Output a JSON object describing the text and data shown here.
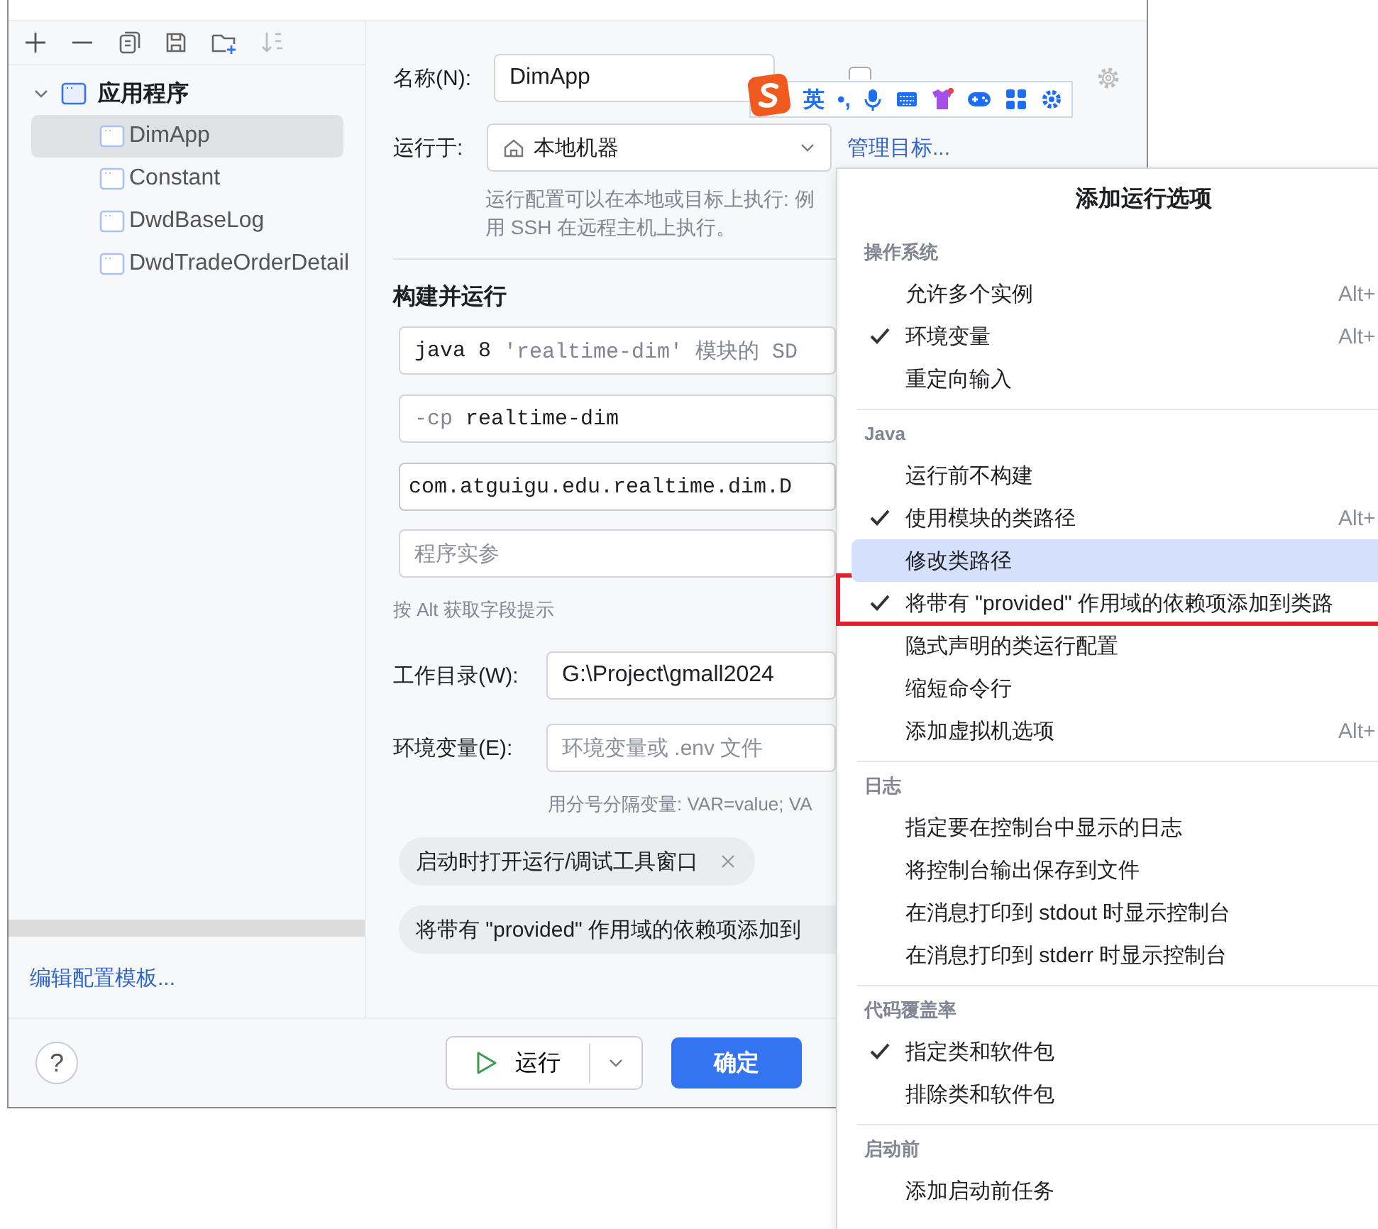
{
  "sidebar": {
    "tree": {
      "label": "应用程序",
      "expanded": true,
      "children": [
        {
          "label": "DimApp",
          "selected": true
        },
        {
          "label": "Constant",
          "selected": false
        },
        {
          "label": "DwdBaseLog",
          "selected": false
        },
        {
          "label": "DwdTradeOrderDetail",
          "selected": false
        }
      ]
    },
    "template_link": "编辑配置模板..."
  },
  "form": {
    "name_label": "名称(N):",
    "name_value": "DimApp",
    "store_checkbox": {
      "checked": false
    },
    "run_on_label": "运行于:",
    "run_on_value": "本地机器",
    "manage_link": "管理目标...",
    "run_on_hint": [
      "运行配置可以在本地或目标上执行: 例",
      "用 SSH 在远程主机上执行。"
    ],
    "section_title": "构建并运行",
    "jre": {
      "value": "java 8",
      "hint": "'realtime-dim' 模块的 SD"
    },
    "classpath": {
      "flag": "-cp",
      "value": "realtime-dim"
    },
    "main_class": "com.atguigu.edu.realtime.dim.D",
    "program_args": {
      "placeholder": "程序实参"
    },
    "field_hint": "按 Alt 获取字段提示",
    "workdir_label": "工作目录(W):",
    "workdir_value": "G:\\Project\\gmall2024",
    "env_label": "环境变量(E):",
    "env_placeholder": "环境变量或 .env 文件",
    "env_hint": "用分号分隔变量: VAR=value; VA",
    "chips": [
      {
        "label": "启动时打开运行/调试工具窗口",
        "removable": true
      },
      {
        "label": "将带有 \"provided\" 作用域的依赖项添加到",
        "removable": false
      }
    ]
  },
  "footer": {
    "help": "?",
    "run_button": "运行",
    "ok_button": "确定"
  },
  "ime_toolbar": {
    "mode": "英",
    "punct": "•,"
  },
  "menu": {
    "title": "添加运行选项",
    "groups": [
      {
        "label": "操作系统",
        "items": [
          {
            "label": "允许多个实例",
            "checked": false,
            "selected": false,
            "shortcut": "Alt+"
          },
          {
            "label": "环境变量",
            "checked": true,
            "selected": false,
            "shortcut": "Alt+"
          },
          {
            "label": "重定向输入",
            "checked": false,
            "selected": false
          }
        ]
      },
      {
        "label": "Java",
        "items": [
          {
            "label": "运行前不构建",
            "checked": false,
            "selected": false
          },
          {
            "label": "使用模块的类路径",
            "checked": true,
            "selected": false,
            "shortcut": "Alt+"
          },
          {
            "label": "修改类路径",
            "checked": false,
            "selected": true
          },
          {
            "label": "将带有 \"provided\" 作用域的依赖项添加到类路",
            "checked": true,
            "selected": false
          },
          {
            "label": "隐式声明的类运行配置",
            "checked": false,
            "selected": false
          },
          {
            "label": "缩短命令行",
            "checked": false,
            "selected": false
          },
          {
            "label": "添加虚拟机选项",
            "checked": false,
            "selected": false,
            "shortcut": "Alt+"
          }
        ]
      },
      {
        "label": "日志",
        "items": [
          {
            "label": "指定要在控制台中显示的日志",
            "checked": false,
            "selected": false
          },
          {
            "label": "将控制台输出保存到文件",
            "checked": false,
            "selected": false
          },
          {
            "label": "在消息打印到 stdout 时显示控制台",
            "checked": false,
            "selected": false
          },
          {
            "label": "在消息打印到 stderr 时显示控制台",
            "checked": false,
            "selected": false
          }
        ]
      },
      {
        "label": "代码覆盖率",
        "items": [
          {
            "label": "指定类和软件包",
            "checked": true,
            "selected": false
          },
          {
            "label": "排除类和软件包",
            "checked": false,
            "selected": false
          }
        ]
      },
      {
        "label": "启动前",
        "items": [
          {
            "label": "添加启动前任务",
            "checked": false,
            "selected": false
          }
        ]
      }
    ]
  }
}
